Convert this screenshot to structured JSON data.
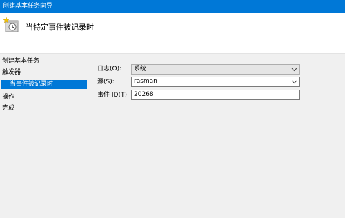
{
  "window": {
    "title": "创建基本任务向导"
  },
  "header": {
    "title": "当特定事件被记录时",
    "icon": "clock-task-icon"
  },
  "sidebar": {
    "items": [
      {
        "label": "创建基本任务",
        "selected": false
      },
      {
        "label": "触发器",
        "selected": false
      },
      {
        "label": "当事件被记录时",
        "selected": true
      },
      {
        "label": "操作",
        "selected": false
      },
      {
        "label": "完成",
        "selected": false
      }
    ]
  },
  "form": {
    "log": {
      "label": "日志(O):",
      "value": "系统",
      "enabled": false
    },
    "source": {
      "label": "源(S):",
      "value": "rasman"
    },
    "event_id": {
      "label": "事件 ID(T):",
      "value": "20268"
    }
  },
  "colors": {
    "accent": "#0078d7",
    "background": "#f0f0f0"
  }
}
